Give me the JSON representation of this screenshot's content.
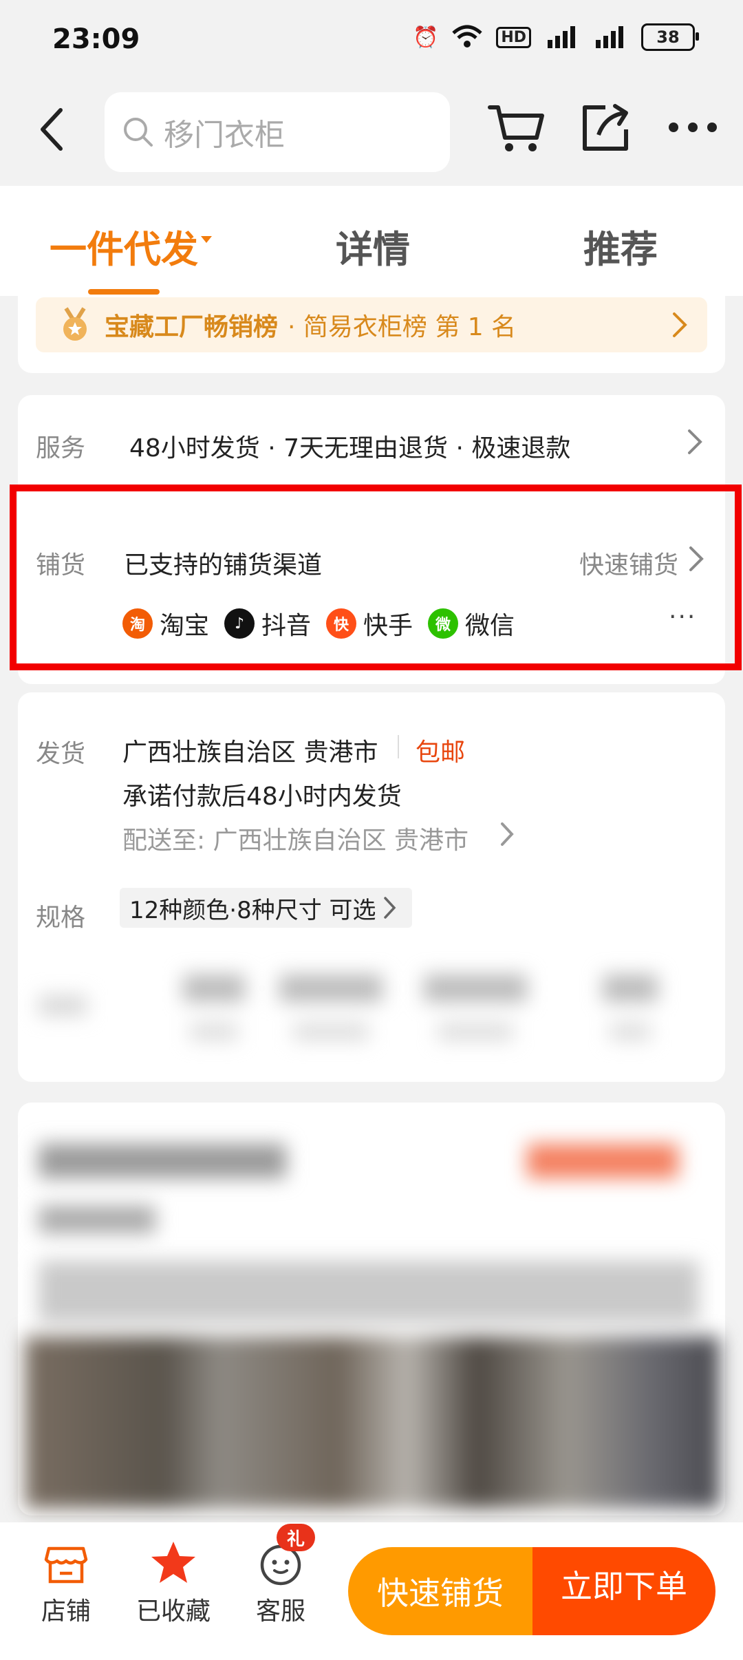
{
  "status_bar": {
    "time": "23:09",
    "battery": "38"
  },
  "header": {
    "search_placeholder": "移门衣柜"
  },
  "tabs": [
    {
      "label": "一件代发",
      "active": true
    },
    {
      "label": "详情",
      "active": false
    },
    {
      "label": "推荐",
      "active": false
    }
  ],
  "rank": {
    "title": "宝藏工厂畅销榜",
    "subtitle": "· 简易衣柜榜  第 1 名"
  },
  "service": {
    "label": "服务",
    "text": "48小时发货 · 7天无理由退货 · 极速退款"
  },
  "puhuo": {
    "label": "铺货",
    "text": "已支持的铺货渠道",
    "quick_link": "快速铺货",
    "channels": [
      {
        "name": "淘宝",
        "icon": "taobao-icon",
        "glyph": "淘",
        "color": "#f25c05"
      },
      {
        "name": "抖音",
        "icon": "douyin-icon",
        "glyph": "♪",
        "color": "#111111"
      },
      {
        "name": "快手",
        "icon": "kuaishou-icon",
        "glyph": "快",
        "color": "#ff4f18"
      },
      {
        "name": "微信",
        "icon": "wechat-icon",
        "glyph": "微",
        "color": "#2dc100"
      }
    ],
    "more": "···"
  },
  "shipping": {
    "label": "发货",
    "origin": "广西壮族自治区 贵港市",
    "free": "包邮",
    "promise": "承诺付款后48小时内发货",
    "destination": "配送至:  广西壮族自治区 贵港市"
  },
  "spec": {
    "label": "规格",
    "text": "12种颜色·8种尺寸 可选"
  },
  "bottom_bar": {
    "store": "店铺",
    "favorite": "已收藏",
    "service": "客服",
    "gift_badge": "礼",
    "quick_button": "快速铺货",
    "buy_button": "立即下单"
  },
  "colors": {
    "accent": "#f27c0d",
    "orange_button": "#ff9a00",
    "red_button": "#ff4a00",
    "highlight_frame": "#f20000"
  }
}
